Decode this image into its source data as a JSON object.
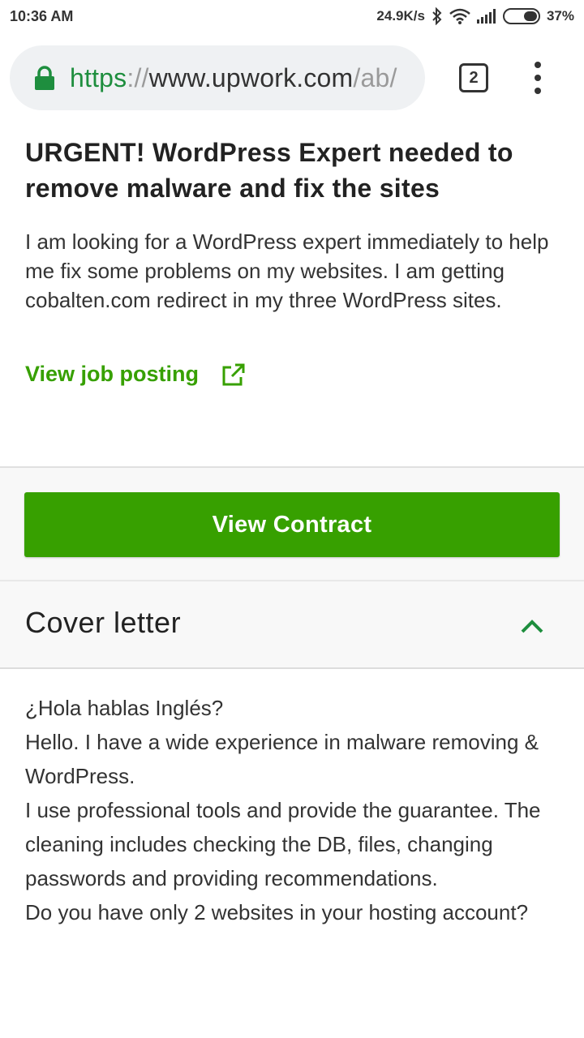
{
  "status_bar": {
    "time": "10:36 AM",
    "network_speed": "24.9K/s",
    "battery": "37%",
    "icons": [
      "bluetooth-icon",
      "wifi-icon",
      "signal-icon",
      "battery-icon"
    ]
  },
  "browser": {
    "url_scheme": "https",
    "url_sep": "://",
    "url_host": "www.upwork.com",
    "url_rest": "/ab/",
    "tab_count": "2"
  },
  "job": {
    "title": "URGENT! WordPress Expert needed to remove malware and fix the sites",
    "description": "I am looking for a WordPress expert immediately to help me fix some problems on my websites. I am getting cobalten.com redirect in my three WordPress sites.",
    "link_label": "View job posting"
  },
  "contract": {
    "button_label": "View Contract"
  },
  "cover_letter": {
    "title": "Cover letter",
    "lines": [
      "¿Hola hablas Inglés?",
      "Hello. I have a wide experience in malware removing & WordPress.",
      "I use professional tools and provide the guarantee. The cleaning includes checking the DB, files, changing passwords and providing recommendations.",
      "Do you have only 2 websites in your hosting account?"
    ]
  },
  "colors": {
    "accent_green": "#37a000",
    "url_green": "#1e8e3e"
  }
}
